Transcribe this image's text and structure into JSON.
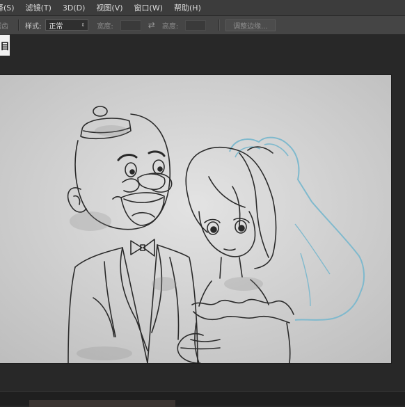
{
  "menu": {
    "items": [
      {
        "label": "择(S)"
      },
      {
        "label": "滤镜(T)"
      },
      {
        "label": "3D(D)"
      },
      {
        "label": "视图(V)"
      },
      {
        "label": "窗口(W)"
      },
      {
        "label": "帮助(H)"
      }
    ]
  },
  "options": {
    "leading_fragment": "锯齿",
    "style_label": "样式:",
    "style_value": "正常",
    "width_label": "宽度:",
    "height_label": "高度:",
    "refine_edge_label": "调整边缘..."
  },
  "colors": {
    "menubar": "#3c3c3c",
    "optionsbar": "#454545",
    "workspace": "#282828",
    "paper": "#d9d9d9",
    "pencil": "#2a2a2a",
    "veil": "#7fb9cd"
  }
}
